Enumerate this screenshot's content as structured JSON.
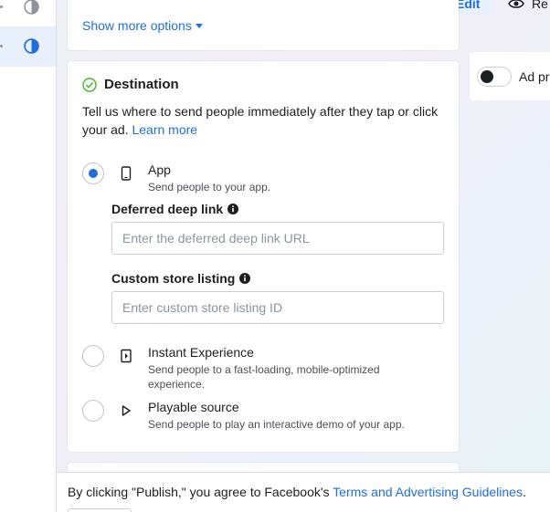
{
  "header": {
    "edit_label": "Edit",
    "review_label": "Re"
  },
  "show_more": {
    "label": "Show more options"
  },
  "destination": {
    "title": "Destination",
    "description": "Tell us where to send people immediately after they tap or click your ad.",
    "learn_more": "Learn more",
    "options": [
      {
        "title": "App",
        "subtitle": "Send people to your app.",
        "selected": true,
        "icon": "mobile-phone-icon"
      },
      {
        "title": "Instant Experience",
        "subtitle": "Send people to a fast-loading, mobile-optimized experience.",
        "selected": false,
        "icon": "instant-experience-icon"
      },
      {
        "title": "Playable source",
        "subtitle": "Send people to play an interactive demo of your app.",
        "selected": false,
        "icon": "play-icon"
      }
    ],
    "deferred_deep_link": {
      "label": "Deferred deep link",
      "placeholder": "Enter the deferred deep link URL",
      "value": ""
    },
    "custom_store_listing": {
      "label": "Custom store listing",
      "placeholder": "Enter custom store listing ID",
      "value": ""
    }
  },
  "preview": {
    "toggle_label": "Ad pr",
    "toggle_on": false
  },
  "footer": {
    "prefix": "By clicking \"Publish,\" you agree to Facebook's ",
    "link": "Terms and Advertising Guidelines",
    "suffix": "."
  },
  "colors": {
    "accent": "#216fdb",
    "text": "#1c1e21",
    "muted": "#4b4f56"
  }
}
